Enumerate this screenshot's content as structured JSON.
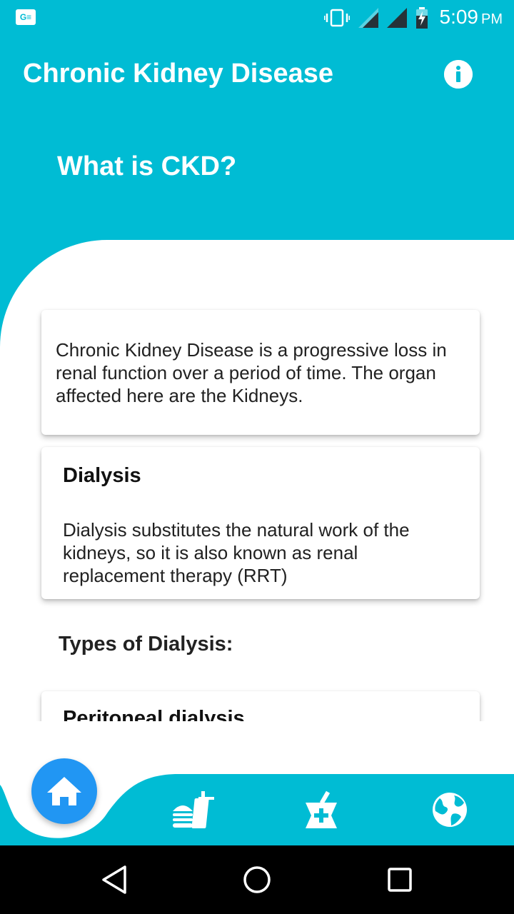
{
  "status_bar": {
    "notification_badge": "G≡",
    "time": "5:09",
    "ampm": "PM",
    "icons": [
      "vibrate-icon",
      "signal-icon",
      "signal-icon",
      "battery-charging-icon"
    ]
  },
  "app_bar": {
    "title": "Chronic Kidney Disease",
    "info_icon": "info-icon"
  },
  "hero": {
    "title": "What is CKD?"
  },
  "cards": {
    "intro": {
      "text": "Chronic Kidney Disease is a progressive loss in renal function over a period of time. The organ affected here are the Kidneys."
    },
    "dialysis": {
      "title": "Dialysis",
      "text": "Dialysis substitutes the natural work of the kidneys, so it is also known as renal replacement therapy (RRT)"
    },
    "peritoneal": {
      "title": "Peritoneal dialysis"
    }
  },
  "section": {
    "types_title": "Types of Dialysis:"
  },
  "bottom_nav": {
    "items": [
      "home-icon",
      "food-icon",
      "medicine-icon",
      "globe-icon"
    ]
  },
  "system_nav": {
    "items": [
      "back-icon",
      "home-circle-icon",
      "recents-icon"
    ]
  },
  "colors": {
    "primary": "#00BCD4",
    "accent": "#2196F3",
    "text": "#212121"
  }
}
